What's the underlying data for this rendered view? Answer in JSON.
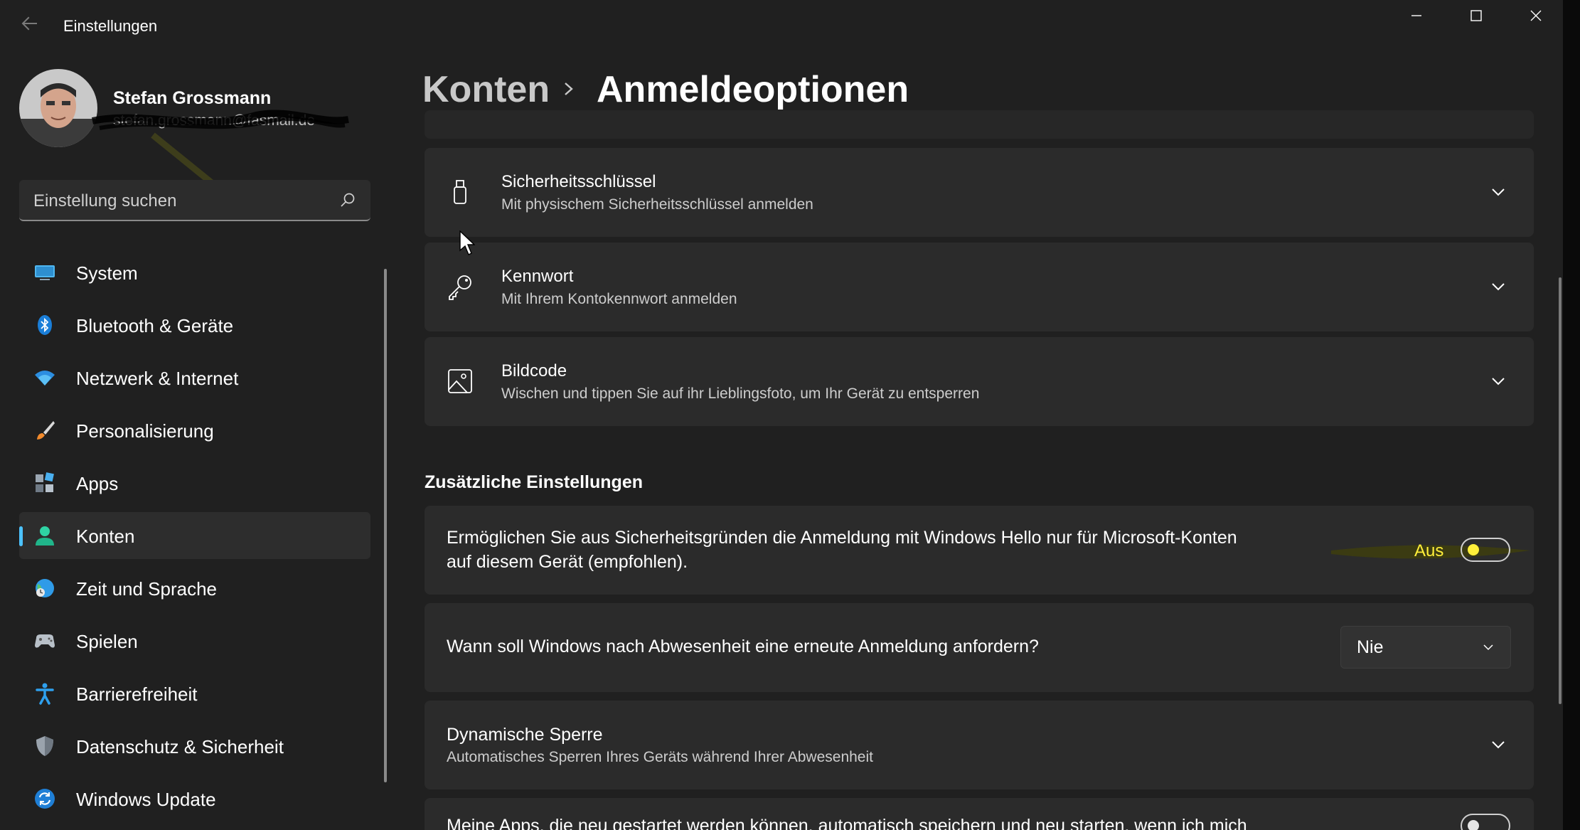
{
  "window": {
    "title": "Einstellungen"
  },
  "profile": {
    "name": "Stefan Grossmann",
    "email": "stefan.grossmann@fasmail.de"
  },
  "search": {
    "placeholder": "Einstellung suchen"
  },
  "nav": {
    "items": [
      {
        "label": "System",
        "icon": "monitor-icon"
      },
      {
        "label": "Bluetooth & Geräte",
        "icon": "bluetooth-icon"
      },
      {
        "label": "Netzwerk & Internet",
        "icon": "wifi-icon"
      },
      {
        "label": "Personalisierung",
        "icon": "brush-icon"
      },
      {
        "label": "Apps",
        "icon": "apps-icon"
      },
      {
        "label": "Konten",
        "icon": "account-icon",
        "active": true
      },
      {
        "label": "Zeit und Sprache",
        "icon": "globe-icon"
      },
      {
        "label": "Spielen",
        "icon": "gamepad-icon"
      },
      {
        "label": "Barrierefreiheit",
        "icon": "accessibility-icon"
      },
      {
        "label": "Datenschutz & Sicherheit",
        "icon": "shield-icon"
      },
      {
        "label": "Windows Update",
        "icon": "update-icon"
      }
    ]
  },
  "header": {
    "parent": "Konten",
    "current": "Anmeldeoptionen"
  },
  "signin_options": [
    {
      "title": "Sicherheitsschlüssel",
      "subtitle": "Mit physischem Sicherheitsschlüssel anmelden",
      "icon": "usb-key-icon"
    },
    {
      "title": "Kennwort",
      "subtitle": "Mit Ihrem Kontokennwort anmelden",
      "icon": "key-icon"
    },
    {
      "title": "Bildcode",
      "subtitle": "Wischen und tippen Sie auf ihr Lieblingsfoto, um Ihr Gerät zu entsperren",
      "icon": "picture-icon"
    }
  ],
  "additional": {
    "section_title": "Zusätzliche Einstellungen",
    "hello_only": {
      "line1": "Ermöglichen Sie aus Sicherheitsgründen die Anmeldung mit Windows Hello nur für Microsoft-Konten",
      "line2": "auf diesem Gerät (empfohlen).",
      "state_label": "Aus",
      "on": false
    },
    "reauth": {
      "question": "Wann soll Windows nach Abwesenheit eine erneute Anmeldung anfordern?",
      "value": "Nie"
    },
    "dynamic_lock": {
      "title": "Dynamische Sperre",
      "subtitle": "Automatisches Sperren Ihres Geräts während Ihrer Abwesenheit"
    },
    "restart_apps": {
      "text": "Meine Apps, die neu gestartet werden können, automatisch speichern und neu starten, wenn ich mich"
    }
  },
  "colors": {
    "accent": "#4cc2ff",
    "highlight": "#ffef3a",
    "background": "#202020",
    "card": "#2b2b2b"
  }
}
